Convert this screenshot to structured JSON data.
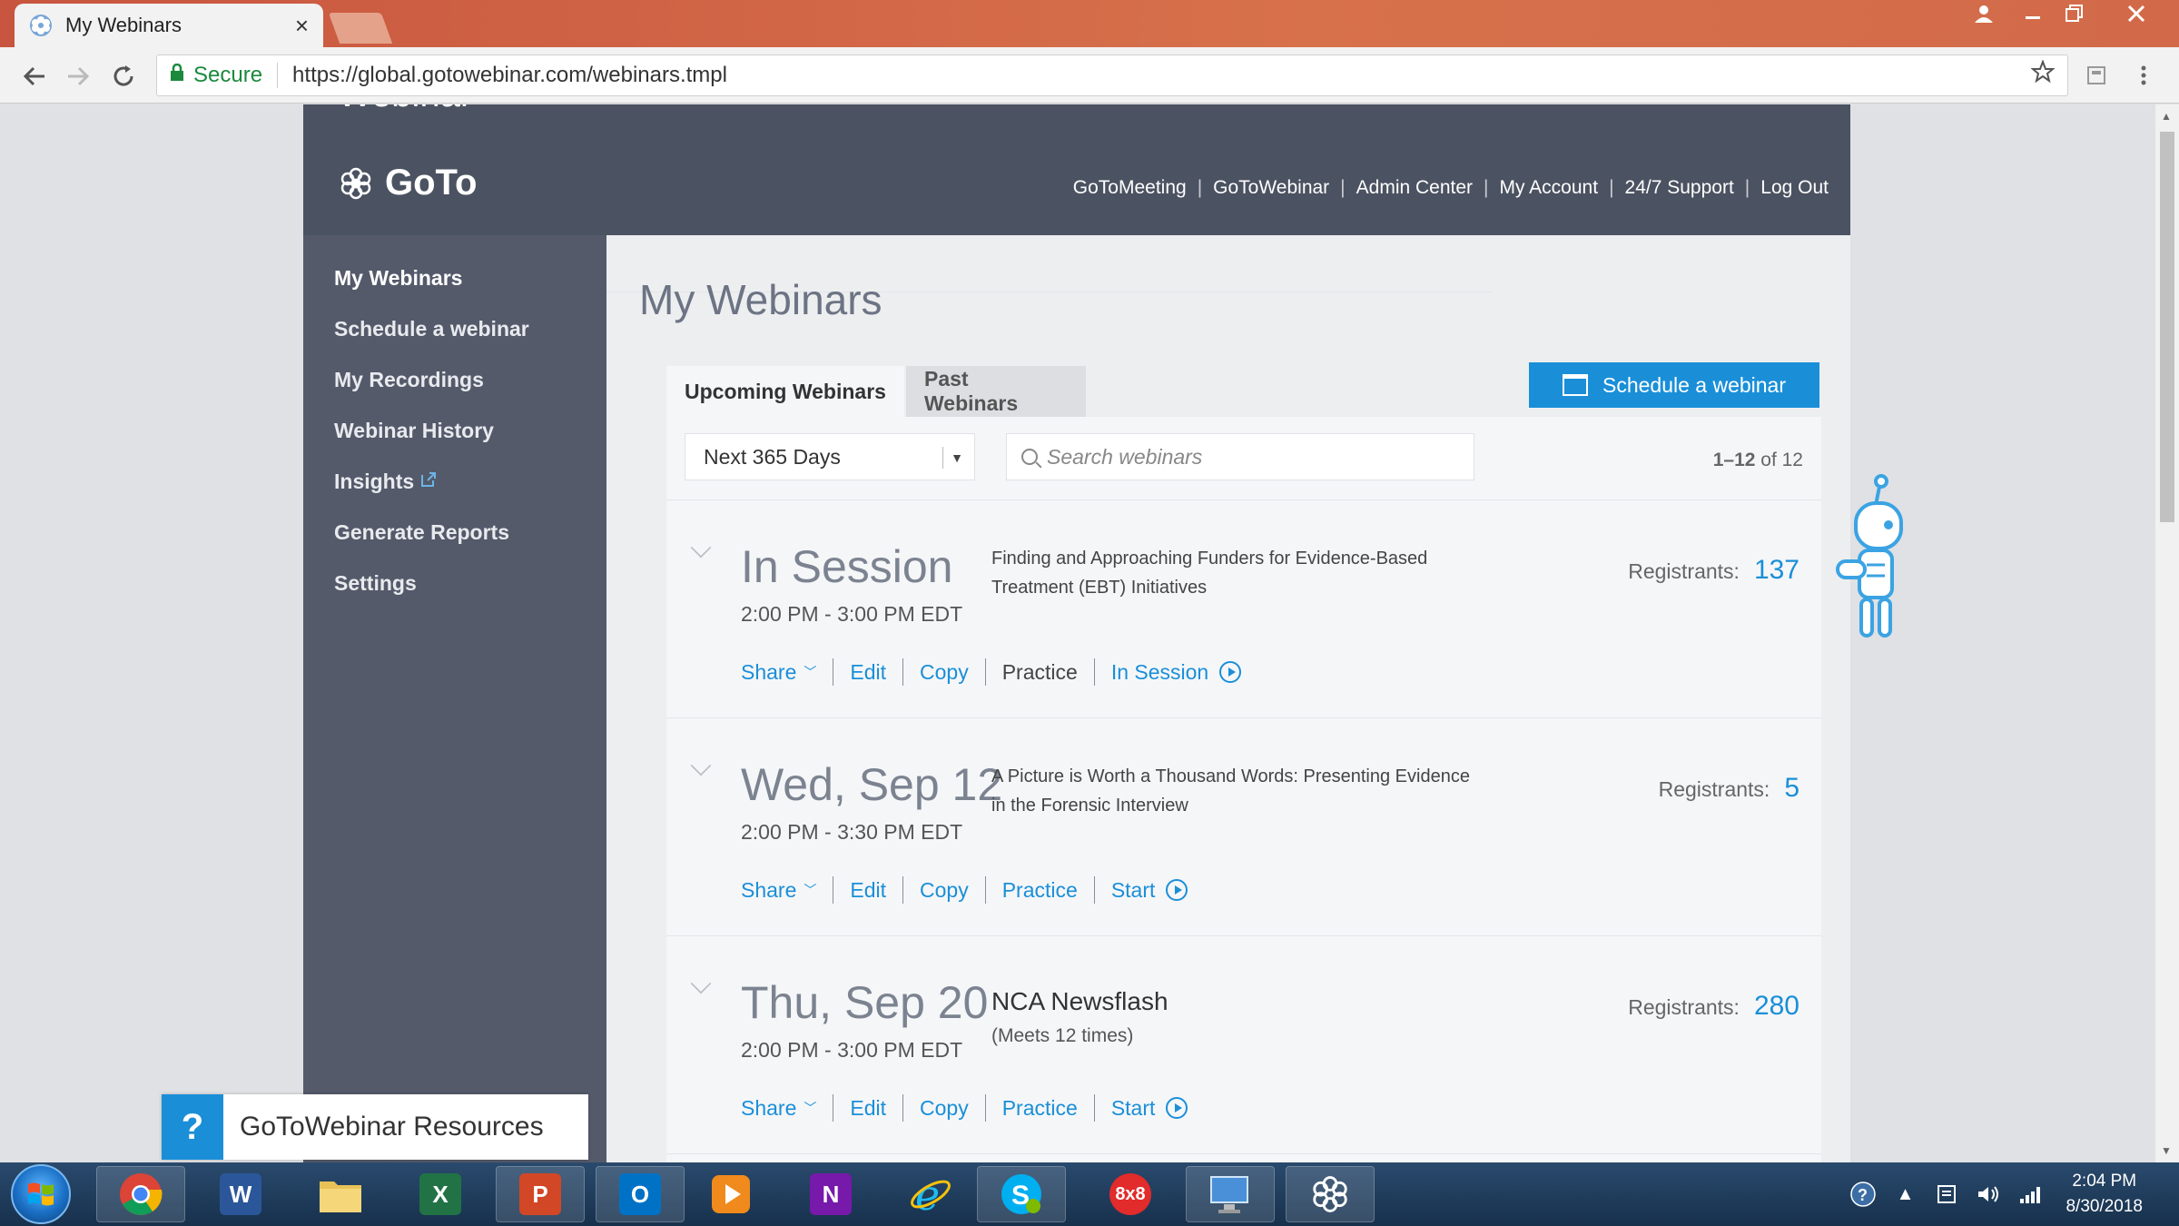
{
  "browser": {
    "tab_title": "My Webinars",
    "tab_close": "×",
    "address": {
      "secure_label": "Secure",
      "url": "https://global.gotowebinar.com/webinars.tmpl"
    }
  },
  "header": {
    "logo_goto": "GoTo",
    "logo_webinar": "Webinar",
    "nav": [
      "GoToMeeting",
      "GoToWebinar",
      "Admin Center",
      "My Account",
      "24/7 Support",
      "Log Out"
    ]
  },
  "sidebar": {
    "items": [
      {
        "label": "My Webinars",
        "active": true
      },
      {
        "label": "Schedule a webinar"
      },
      {
        "label": "My Recordings"
      },
      {
        "label": "Webinar History"
      },
      {
        "label": "Insights",
        "external": true
      },
      {
        "label": "Generate Reports"
      },
      {
        "label": "Settings"
      }
    ]
  },
  "main": {
    "title": "My Webinars",
    "tabs": [
      {
        "label": "Upcoming Webinars",
        "selected": true
      },
      {
        "label": "Past Webinars"
      }
    ],
    "schedule_button": "Schedule a webinar",
    "filter": {
      "range_selected": "Next 365 Days",
      "search_placeholder": "Search webinars",
      "pager_range": "1–12",
      "pager_of": "of 12"
    },
    "webinars": [
      {
        "date": "In Session",
        "time": "2:00 PM - 3:00 PM EDT",
        "title": "Finding and Approaching Funders for Evidence-Based Treatment (EBT) Initiatives",
        "registrants_label": "Registrants:",
        "registrants": "137",
        "actions": [
          "Share",
          "Edit",
          "Copy",
          "Practice",
          "In Session"
        ]
      },
      {
        "date": "Wed, Sep 12",
        "time": "2:00 PM - 3:30 PM EDT",
        "title": "A Picture is Worth a Thousand Words: Presenting Evidence in the Forensic Interview",
        "registrants_label": "Registrants:",
        "registrants": "5",
        "actions": [
          "Share",
          "Edit",
          "Copy",
          "Practice",
          "Start"
        ]
      },
      {
        "date": "Thu, Sep 20",
        "time": "2:00 PM - 3:00 PM EDT",
        "title": "NCA Newsflash",
        "subtitle": "(Meets 12 times)",
        "registrants_label": "Registrants:",
        "registrants": "280",
        "actions": [
          "Share",
          "Edit",
          "Copy",
          "Practice",
          "Start"
        ]
      }
    ]
  },
  "resources_widget": {
    "icon": "?",
    "label": "GoToWebinar Resources"
  },
  "taskbar": {
    "apps": [
      "chrome",
      "word",
      "file-explorer",
      "excel",
      "powerpoint",
      "outlook",
      "media-player",
      "onenote",
      "internet-explorer",
      "skype",
      "8x8",
      "remote-desktop",
      "gotowebinar"
    ],
    "app_8x8_label": "8x8",
    "clock_time": "2:04 PM",
    "clock_date": "8/30/2018"
  },
  "colors": {
    "accent": "#1a8fd8",
    "header_bg": "#4b5261",
    "sidebar_bg": "#545a6a"
  }
}
